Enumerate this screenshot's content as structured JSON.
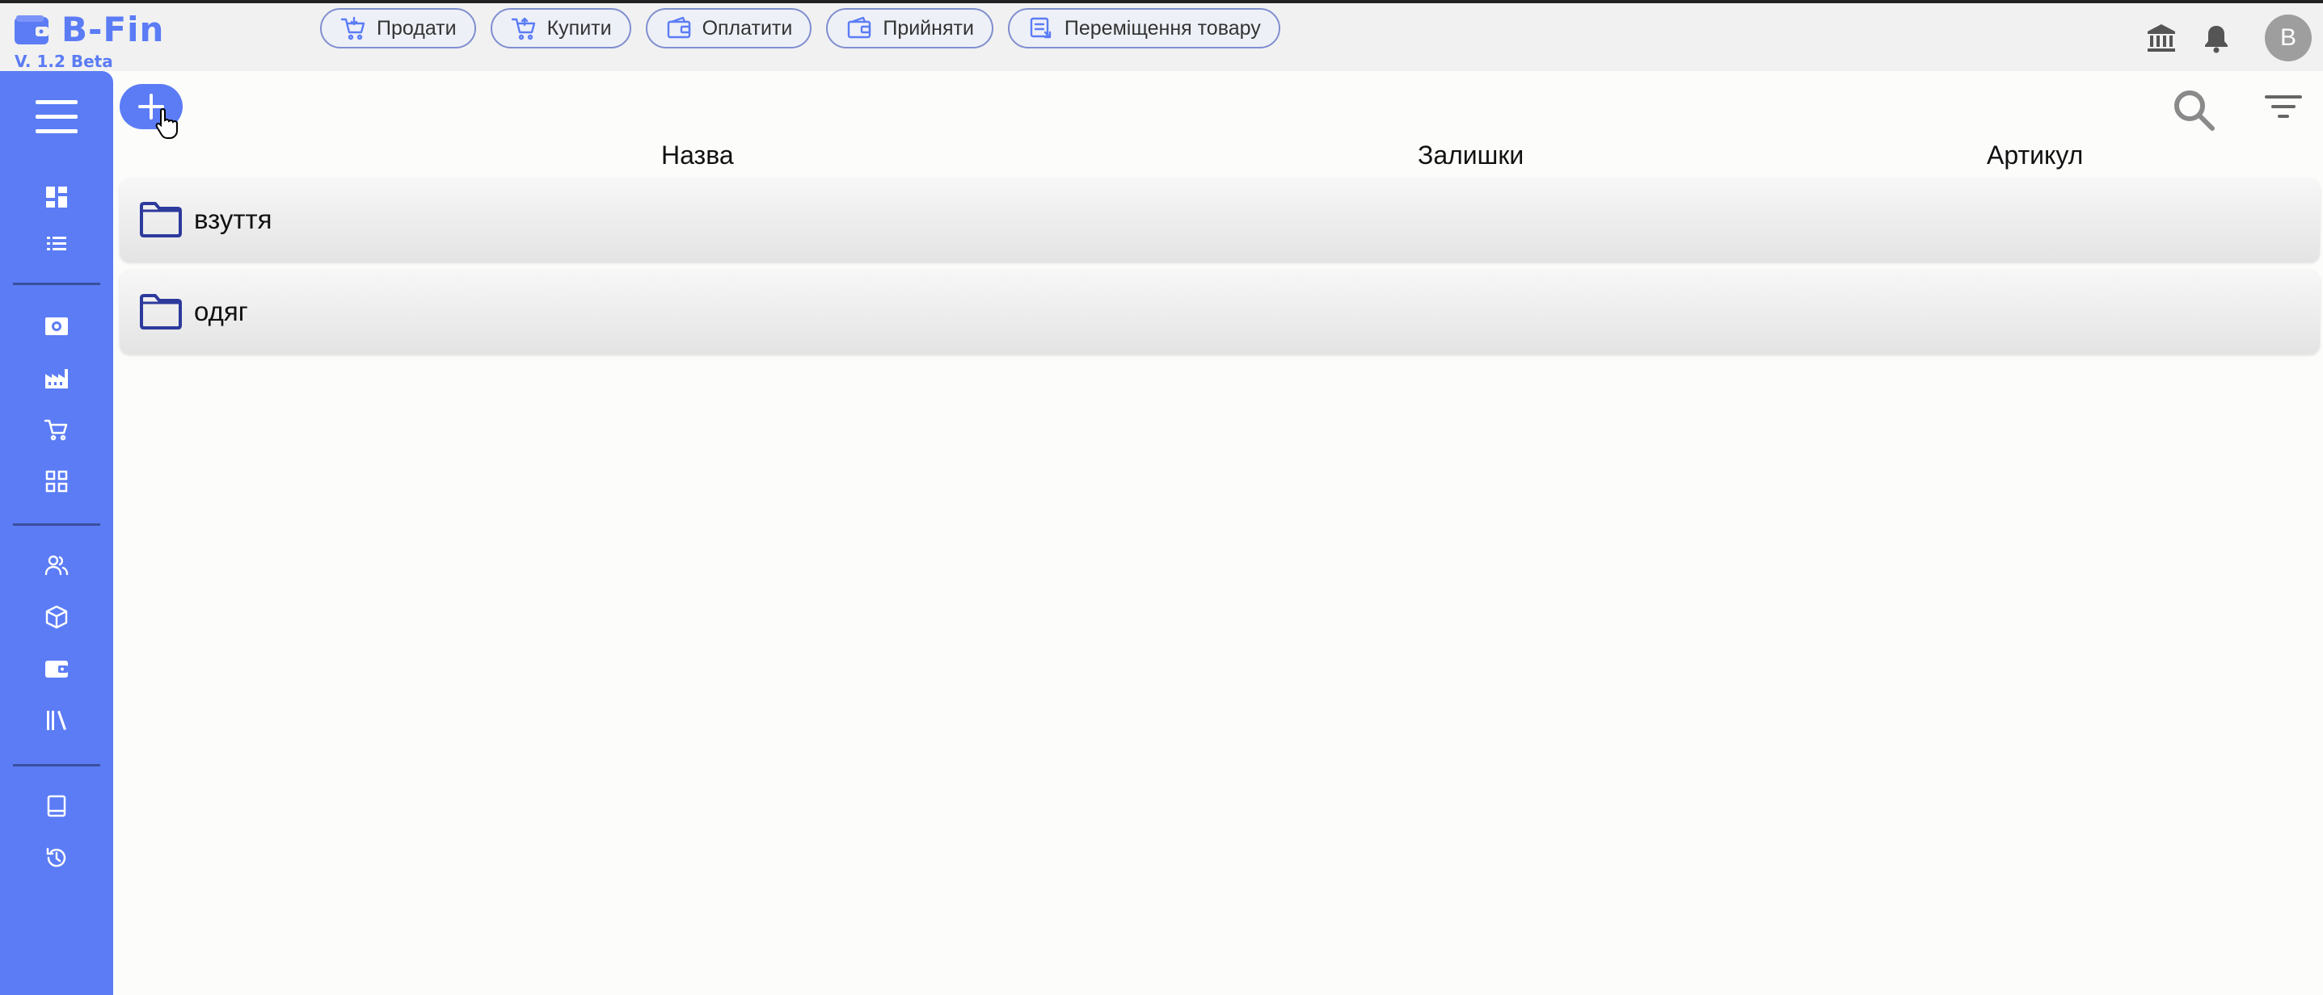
{
  "app": {
    "title": "B-Fin",
    "version": "V. 1.2 Beta",
    "brand_color": "#5b7cf5"
  },
  "header": {
    "actions": [
      {
        "label": "Продати",
        "icon": "cart-icon"
      },
      {
        "label": "Купити",
        "icon": "cart-icon"
      },
      {
        "label": "Оплатити",
        "icon": "wallet-icon"
      },
      {
        "label": "Прийняти",
        "icon": "wallet-icon"
      },
      {
        "label": "Переміщення товару",
        "icon": "transfer-icon"
      }
    ],
    "avatar_letter": "B",
    "icons": [
      "bank-icon",
      "bell-icon"
    ]
  },
  "sidebar": {
    "items": [
      "dashboard-icon",
      "list-icon",
      "cash-icon",
      "factory-icon",
      "cart-icon",
      "grid-icon",
      "people-icon",
      "box-icon",
      "wallet-icon",
      "library-icon",
      "book-icon",
      "history-icon"
    ]
  },
  "table": {
    "columns": {
      "name": "Назва",
      "stock": "Залишки",
      "sku": "Артикул"
    },
    "rows": [
      {
        "type": "folder",
        "name": "взуття"
      },
      {
        "type": "folder",
        "name": "одяг"
      }
    ]
  }
}
